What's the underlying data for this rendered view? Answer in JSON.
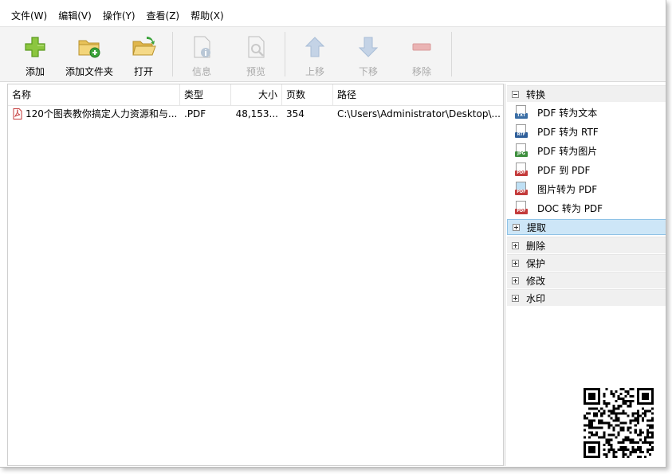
{
  "menu": [
    {
      "label": "文件(W)"
    },
    {
      "label": "编辑(V)"
    },
    {
      "label": "操作(Y)"
    },
    {
      "label": "查看(Z)"
    },
    {
      "label": "帮助(X)"
    }
  ],
  "toolbar": {
    "add": "添加",
    "add_folder": "添加文件夹",
    "open": "打开",
    "info": "信息",
    "preview": "预览",
    "move_up": "上移",
    "move_down": "下移",
    "remove": "移除"
  },
  "list": {
    "headers": {
      "name": "名称",
      "type": "类型",
      "size": "大小",
      "pages": "页数",
      "path": "路径"
    },
    "rows": [
      {
        "name": "120个图表教你搞定人力资源和与...",
        "type": ".PDF",
        "size": "48,153...",
        "pages": "354",
        "path": "C:\\Users\\Administrator\\Desktop\\..."
      }
    ]
  },
  "panel": {
    "convert": {
      "label": "转换",
      "items": [
        {
          "label": "PDF 转为文本",
          "tag": "TXT",
          "color": "#3a6ea5"
        },
        {
          "label": "PDF 转为 RTF",
          "tag": "RTF",
          "color": "#2f5f9a"
        },
        {
          "label": "PDF 转为图片",
          "tag": "JPG",
          "color": "#3d8f3d"
        },
        {
          "label": "PDF 到 PDF",
          "tag": "PDF",
          "color": "#c43b3b"
        },
        {
          "label": "图片转为 PDF",
          "tag": "PDF",
          "color": "#c43b3b"
        },
        {
          "label": "DOC 转为 PDF",
          "tag": "PDF",
          "color": "#c43b3b"
        }
      ]
    },
    "extract": "提取",
    "delete": "删除",
    "protect": "保护",
    "modify": "修改",
    "watermark": "水印"
  }
}
